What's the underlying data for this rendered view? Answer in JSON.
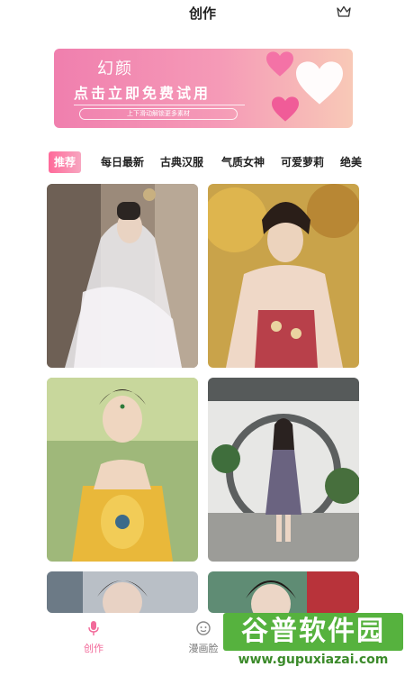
{
  "header": {
    "title": "创作",
    "crown_icon": "crown-icon"
  },
  "banner": {
    "title": "幻颜",
    "subtitle": "点击立即免费试用",
    "hint": "上下滑动解锁更多素材",
    "colors": {
      "start": "#f07fae",
      "end": "#f8c9b7"
    }
  },
  "tabs": [
    {
      "label": "推荐",
      "active": true
    },
    {
      "label": "每日最新",
      "active": false
    },
    {
      "label": "古典汉服",
      "active": false
    },
    {
      "label": "气质女神",
      "active": false
    },
    {
      "label": "可爱萝莉",
      "active": false
    },
    {
      "label": "绝美",
      "active": false
    }
  ],
  "gallery": [
    {
      "name": "photo-veil-bride"
    },
    {
      "name": "photo-hanfu-autumn"
    },
    {
      "name": "photo-yellow-dance-costume"
    },
    {
      "name": "photo-garden-round-gate"
    },
    {
      "name": "photo-portrait-5"
    },
    {
      "name": "photo-portrait-6"
    }
  ],
  "bottom_nav": [
    {
      "label": "创作",
      "icon": "microphone-icon",
      "active": true,
      "color": "#f26a9a"
    },
    {
      "label": "漫画脸",
      "icon": "face-icon",
      "active": false,
      "color": "#888888"
    }
  ],
  "watermark": {
    "top": "谷普软件园",
    "bottom": "www.gupuxiazai.com"
  }
}
